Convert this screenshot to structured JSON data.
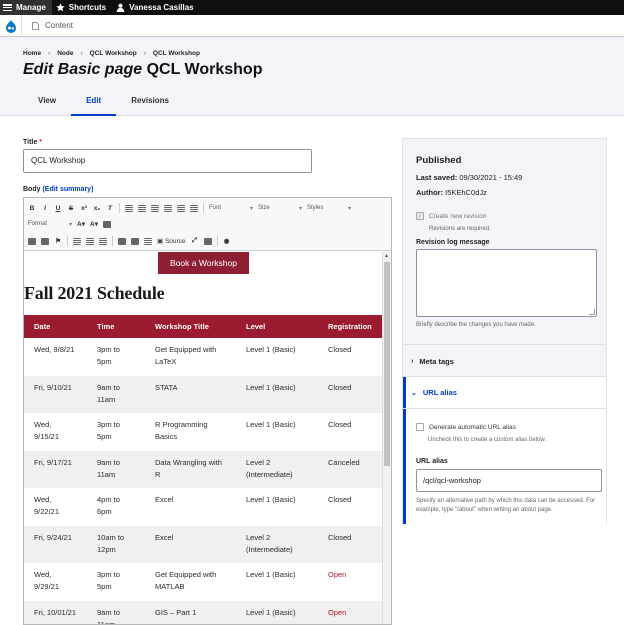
{
  "toolbar": {
    "manage": "Manage",
    "shortcuts": "Shortcuts",
    "user": "Vanessa Casillas"
  },
  "tray": {
    "content": "Content"
  },
  "breadcrumb": [
    "Home",
    "Node",
    "QCL Workshop",
    "QCL Workshop"
  ],
  "page_title": {
    "prefix": "Edit Basic page",
    "name": "QCL Workshop"
  },
  "tabs": [
    {
      "label": "View"
    },
    {
      "label": "Edit"
    },
    {
      "label": "Revisions"
    }
  ],
  "form": {
    "title_label": "Title",
    "required_mark": "*",
    "title_value": "QCL Workshop",
    "body_label": "Body",
    "edit_summary": "(Edit summary)"
  },
  "editor_toolbar": {
    "font": "Font",
    "size": "Size",
    "styles": "Styles",
    "format": "Format",
    "source": "Source"
  },
  "content": {
    "button": "Book a Workshop",
    "heading": "Fall 2021 Schedule",
    "headers": [
      "Date",
      "Time",
      "Workshop Title",
      "Level",
      "Registration"
    ],
    "rows": [
      {
        "date": "Wed, 9/8/21",
        "time": "3pm to 5pm",
        "title": "Get Equipped with LaTeX",
        "level": "Level 1 (Basic)",
        "reg": "Closed"
      },
      {
        "date": "Fri, 9/10/21",
        "time": "9am to 11am",
        "title": "STATA",
        "level": "Level 1 (Basic)",
        "reg": "Closed"
      },
      {
        "date": "Wed, 9/15/21",
        "time": "3pm to 5pm",
        "title": "R Programming Basics",
        "level": "Level 1 (Basic)",
        "reg": "Closed"
      },
      {
        "date": "Fri, 9/17/21",
        "time": "9am to 11am",
        "title": "Data Wrangling with R",
        "level": "Level 2 (Intermediate)",
        "reg": "Canceled"
      },
      {
        "date": "Wed, 9/22/21",
        "time": "4pm to 6pm",
        "title": "Excel",
        "level": "Level 1 (Basic)",
        "reg": "Closed"
      },
      {
        "date": "Fri, 9/24/21",
        "time": "10am to 12pm",
        "title": "Excel",
        "level": "Level 2 (Intermediate)",
        "reg": "Closed"
      },
      {
        "date": "Wed, 9/29/21",
        "time": "3pm to 5pm",
        "title": "Get Equipped with MATLAB",
        "level": "Level 1 (Basic)",
        "reg": "Open"
      },
      {
        "date": "Fri, 10/01/21",
        "time": "9am to 11am",
        "title": "GIS – Part 1",
        "level": "Level 1 (Basic)",
        "reg": "Open"
      }
    ]
  },
  "sidebar": {
    "status": "Published",
    "last_saved_label": "Last saved:",
    "last_saved_value": "09/30/2021 - 15:49",
    "author_label": "Author:",
    "author_value": "I5KEhC0dJz",
    "new_revision": "Create new revision",
    "revisions_required": "Revisions are required.",
    "log_label": "Revision log message",
    "log_help": "Briefly describe the changes you have made.",
    "meta_tags": "Meta tags",
    "url_alias_section": "URL alias",
    "generate_alias": "Generate automatic URL alias",
    "generate_help": "Uncheck this to create a custom alias below.",
    "alias_label": "URL alias",
    "alias_value": "/qcl/qcl-workshop",
    "alias_help": "Specify an alternative path by which this data can be accessed. For example, type \"/about\" when writing an about page."
  },
  "colors": {
    "accent": "#003cc5",
    "brand": "#9b1b30",
    "open": "#b0162c"
  }
}
